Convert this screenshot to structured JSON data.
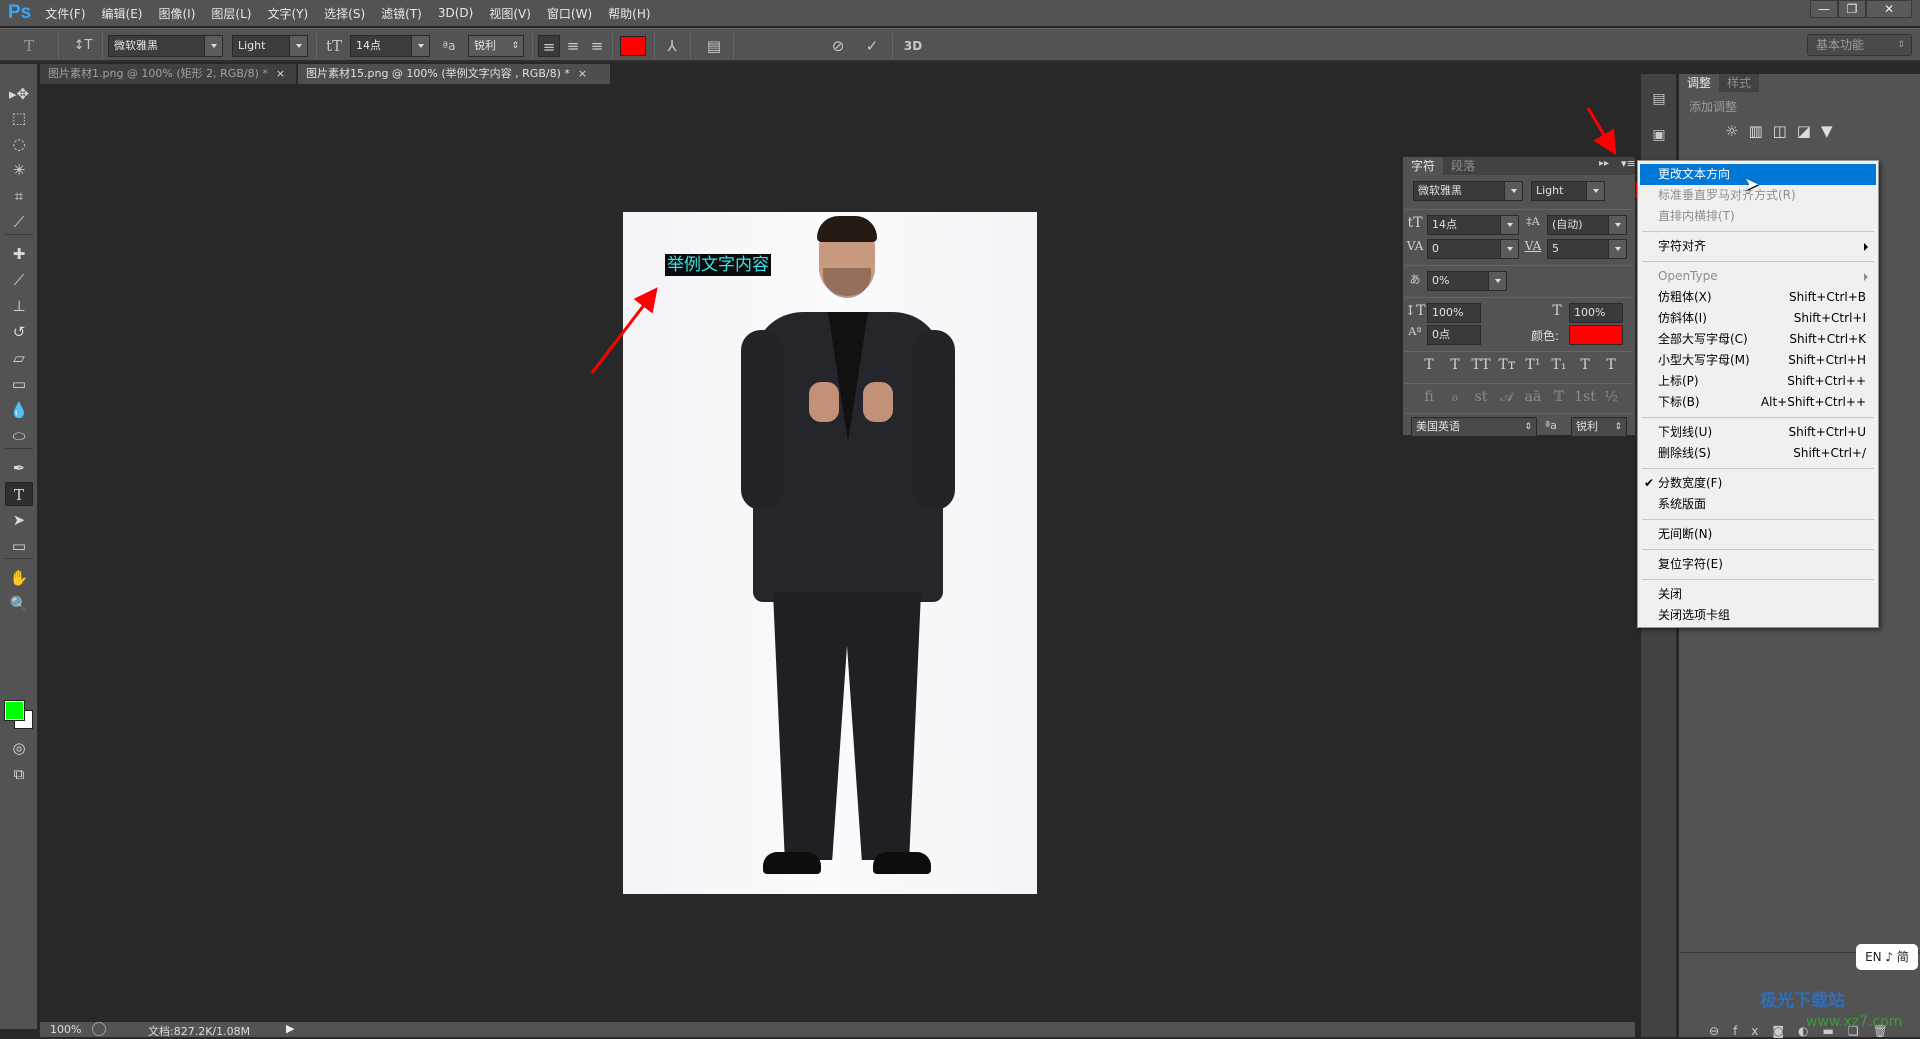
{
  "app": {
    "logo": "Ps",
    "accent": "#31a8ff"
  },
  "menu": [
    "文件(F)",
    "编辑(E)",
    "图像(I)",
    "图层(L)",
    "文字(Y)",
    "选择(S)",
    "滤镜(T)",
    "3D(D)",
    "视图(V)",
    "窗口(W)",
    "帮助(H)"
  ],
  "window_controls": {
    "minimize": "—",
    "restore": "❐",
    "close": "✕"
  },
  "options_bar": {
    "tool_icon": "T",
    "orientation_icon": "↕T",
    "font_family": "微软雅黑",
    "font_style": "Light",
    "size_icon": "tT",
    "font_size": "14点",
    "aa_icon": "ªa",
    "antialias": "锐利",
    "align_left": "≡",
    "align_center": "≡",
    "align_right": "≡",
    "text_color": "#ff0000",
    "warp_icon": "⅄",
    "panels_icon": "▤",
    "cancel_icon": "⊘",
    "commit_icon": "✓",
    "threed_label": "3D",
    "workspace": "基本功能"
  },
  "tabs": [
    {
      "label": "图片素材1.png @ 100% (矩形 2, RGB/8) *",
      "close": "×",
      "active": false
    },
    {
      "label": "图片素材15.png @ 100% (举例文字内容 , RGB/8) *",
      "close": "×",
      "active": true
    }
  ],
  "tools": [
    {
      "name": "move-tool",
      "glyph": "▸✥"
    },
    {
      "name": "marquee-tool",
      "glyph": "⬚"
    },
    {
      "name": "lasso-tool",
      "glyph": "◌"
    },
    {
      "name": "magic-wand-tool",
      "glyph": "✳"
    },
    {
      "name": "crop-tool",
      "glyph": "⌗"
    },
    {
      "name": "eyedropper-tool",
      "glyph": "⟋"
    },
    {
      "name": "healing-brush-tool",
      "glyph": "✚"
    },
    {
      "name": "brush-tool",
      "glyph": "⟋"
    },
    {
      "name": "stamp-tool",
      "glyph": "⊥"
    },
    {
      "name": "history-brush-tool",
      "glyph": "↺"
    },
    {
      "name": "eraser-tool",
      "glyph": "▱"
    },
    {
      "name": "gradient-tool",
      "glyph": "▭"
    },
    {
      "name": "blur-tool",
      "glyph": "💧"
    },
    {
      "name": "dodge-tool",
      "glyph": "⬭"
    },
    {
      "name": "pen-tool",
      "glyph": "✒"
    },
    {
      "name": "type-tool",
      "glyph": "T"
    },
    {
      "name": "path-select-tool",
      "glyph": "➤"
    },
    {
      "name": "shape-tool",
      "glyph": "▭"
    },
    {
      "name": "hand-tool",
      "glyph": "✋"
    },
    {
      "name": "zoom-tool",
      "glyph": "🔍"
    }
  ],
  "colors": {
    "foreground": "#00ff00",
    "background": "#ffffff"
  },
  "canvas": {
    "text_layer": "举例文字内容",
    "text_color": "#38e4ea"
  },
  "status": {
    "zoom": "100%",
    "doc": "文档:827.2K/1.08M"
  },
  "adjustments_panel": {
    "tabs": [
      "调整",
      "样式"
    ],
    "heading": "添加调整"
  },
  "character_panel": {
    "tabs": [
      "字符",
      "段落"
    ],
    "font_family": "微软雅黑",
    "font_style": "Light",
    "size": "14点",
    "leading": "(自动)",
    "kerning": "0",
    "tracking": "5",
    "tsume": "0%",
    "vertical_scale": "100%",
    "horizontal_scale": "100%",
    "baseline": "0点",
    "color_label": "颜色:",
    "color": "#ff0000",
    "style_buttons": [
      "T",
      "T",
      "TT",
      "Tт",
      "T¹",
      "T₁",
      "T",
      "T"
    ],
    "opentype_buttons": [
      "ﬁ",
      "ℴ",
      "st",
      "𝒜",
      "aā",
      "𝕋",
      "1st",
      "½"
    ],
    "language": "美国英语",
    "aa_icon": "ªa",
    "antialias": "锐利"
  },
  "context_menu": {
    "items": [
      {
        "label": "更改文本方向",
        "highlighted": true
      },
      {
        "label": "标准垂直罗马对齐方式(R)",
        "disabled": true
      },
      {
        "label": "直排内横排(T)",
        "disabled": true
      },
      {
        "separator": true
      },
      {
        "label": "字符对齐",
        "submenu": true
      },
      {
        "separator": true
      },
      {
        "label": "OpenType",
        "disabled": true,
        "submenu": true
      },
      {
        "label": "仿粗体(X)",
        "shortcut": "Shift+Ctrl+B"
      },
      {
        "label": "仿斜体(I)",
        "shortcut": "Shift+Ctrl+I"
      },
      {
        "label": "全部大写字母(C)",
        "shortcut": "Shift+Ctrl+K"
      },
      {
        "label": "小型大写字母(M)",
        "shortcut": "Shift+Ctrl+H"
      },
      {
        "label": "上标(P)",
        "shortcut": "Shift+Ctrl++"
      },
      {
        "label": "下标(B)",
        "shortcut": "Alt+Shift+Ctrl++"
      },
      {
        "separator": true
      },
      {
        "label": "下划线(U)",
        "shortcut": "Shift+Ctrl+U"
      },
      {
        "label": "删除线(S)",
        "shortcut": "Shift+Ctrl+/"
      },
      {
        "separator": true
      },
      {
        "label": "分数宽度(F)",
        "checked": true
      },
      {
        "label": "系统版面"
      },
      {
        "separator": true
      },
      {
        "label": "无间断(N)"
      },
      {
        "separator": true
      },
      {
        "label": "复位字符(E)"
      },
      {
        "separator": true
      },
      {
        "label": "关闭"
      },
      {
        "label": "关闭选项卡组"
      }
    ],
    "check_glyph": "✔"
  },
  "ime": "EN ♪ 简",
  "watermark": {
    "name": "极光下载站",
    "url": "www.xz7.com"
  },
  "layers_footer_icons": [
    "⊖",
    "fx",
    "◙",
    "◐",
    "▬",
    "❏",
    "🗑"
  ],
  "annotation_color": "#ff0000"
}
